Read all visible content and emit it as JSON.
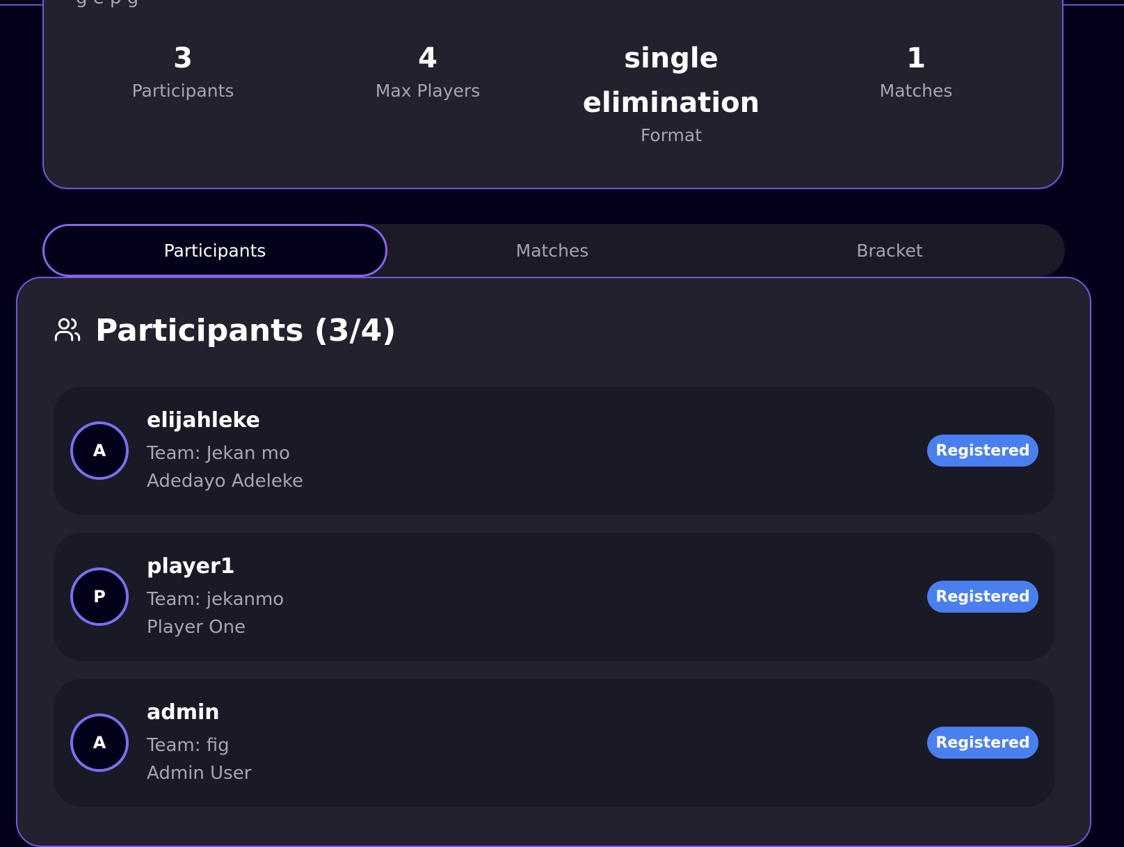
{
  "header": {
    "cut_text": "g e p g"
  },
  "stats": [
    {
      "value": "3",
      "label": "Participants"
    },
    {
      "value": "4",
      "label": "Max Players"
    },
    {
      "value_line1": "single",
      "value_line2": "elimination",
      "label": "Format"
    },
    {
      "value": "1",
      "label": "Matches"
    }
  ],
  "tabs": [
    {
      "label": "Participants",
      "active": true
    },
    {
      "label": "Matches",
      "active": false
    },
    {
      "label": "Bracket",
      "active": false
    }
  ],
  "participants_panel": {
    "title": "Participants (3/4)",
    "icon": "users-icon",
    "items": [
      {
        "initial": "A",
        "username": "elijahleke",
        "team": "Team: Jekan mo",
        "fullname": "Adedayo Adeleke",
        "status": "Registered"
      },
      {
        "initial": "P",
        "username": "player1",
        "team": "Team: jekanmo",
        "fullname": "Player One",
        "status": "Registered"
      },
      {
        "initial": "A",
        "username": "admin",
        "team": "Team: fig",
        "fullname": "Admin User",
        "status": "Registered"
      }
    ]
  },
  "colors": {
    "background": "#03021a",
    "card": "#22212d",
    "row": "#1a1926",
    "accent_border": "#7a55e0",
    "badge": "#4a7ff0"
  }
}
